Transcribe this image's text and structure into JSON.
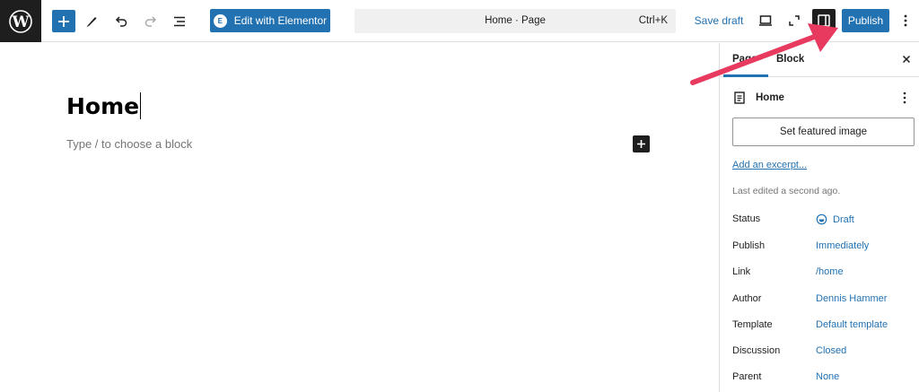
{
  "toolbar": {
    "elementor_label": "Edit with Elementor",
    "elementor_badge": "E",
    "command_title": "Home · Page",
    "command_shortcut": "Ctrl+K",
    "save_draft": "Save draft",
    "publish": "Publish"
  },
  "editor": {
    "title": "Home",
    "placeholder": "Type / to choose a block"
  },
  "sidebar": {
    "tabs": [
      "Page",
      "Block"
    ],
    "active_tab": "Page",
    "document_title": "Home",
    "featured_image_label": "Set featured image",
    "excerpt_link": "Add an excerpt...",
    "last_edited": "Last edited a second ago.",
    "meta": [
      {
        "label": "Status",
        "value": "Draft"
      },
      {
        "label": "Publish",
        "value": "Immediately"
      },
      {
        "label": "Link",
        "value": "/home"
      },
      {
        "label": "Author",
        "value": "Dennis Hammer"
      },
      {
        "label": "Template",
        "value": "Default template"
      },
      {
        "label": "Discussion",
        "value": "Closed"
      },
      {
        "label": "Parent",
        "value": "None"
      }
    ]
  },
  "icons": [
    "wordpress-logo-icon",
    "plus-icon",
    "pencil-icon",
    "undo-icon",
    "redo-icon",
    "list-view-icon",
    "elementor-icon",
    "desktop-preview-icon",
    "fullscreen-icon",
    "sidebar-toggle-icon",
    "more-vertical-icon",
    "close-icon",
    "document-icon",
    "draft-status-icon"
  ],
  "colors": {
    "accent": "#2271b1",
    "dark": "#1e1e1e",
    "annotation_arrow": "#e8395f"
  }
}
